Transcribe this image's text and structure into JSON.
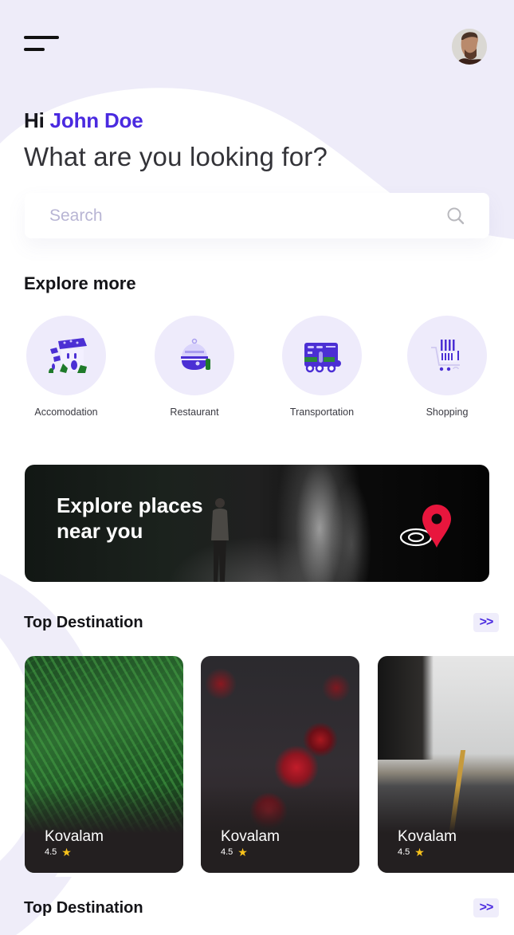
{
  "header": {
    "menu_icon": "hamburger-menu-icon",
    "avatar_alt": "user-avatar"
  },
  "greeting": {
    "hi": "Hi",
    "name": "John Doe",
    "subtitle": "What are you looking for?"
  },
  "search": {
    "placeholder": "Search",
    "value": "",
    "icon": "search-icon"
  },
  "explore": {
    "title": "Explore more",
    "categories": [
      {
        "label": "Accomodation",
        "icon": "house-icon"
      },
      {
        "label": "Restaurant",
        "icon": "cloche-icon"
      },
      {
        "label": "Transportation",
        "icon": "truck-icon"
      },
      {
        "label": "Shopping",
        "icon": "shopping-cart-icon"
      }
    ]
  },
  "banner": {
    "line1": "Explore places",
    "line2": "near you",
    "icon": "location-pin-icon"
  },
  "top_destination": {
    "title": "Top Destination",
    "more_label": ">>",
    "cards": [
      {
        "name": "Kovalam",
        "rating": "4.5"
      },
      {
        "name": "Kovalam",
        "rating": "4.5"
      },
      {
        "name": "Kovalam",
        "rating": "4.5"
      }
    ]
  },
  "top_destination_2": {
    "title": "Top Destination",
    "more_label": ">>"
  },
  "colors": {
    "accent": "#4a2ae0",
    "background_tint": "#eeebfa",
    "pin_red": "#e8163d",
    "star": "#f8c21b"
  }
}
